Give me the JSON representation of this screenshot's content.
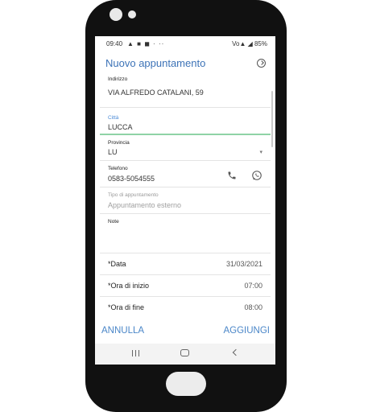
{
  "statusbar": {
    "time": "09:40",
    "notifications": "▲ ■ ◼ ·  ··",
    "right": "Vo▲ ◢ 85%"
  },
  "appbar": {
    "title": "Nuovo appuntamento",
    "action_icon": "clock-save-icon"
  },
  "form": {
    "indirizzo": {
      "label": "Indirizzo",
      "value": "VIA ALFREDO CATALANI, 59"
    },
    "citta": {
      "label": "Città",
      "value": "LUCCA"
    },
    "provincia": {
      "label": "Provincia",
      "value": "LU"
    },
    "telefono": {
      "label": "Telefono",
      "value": "0583-5054555"
    },
    "tipo": {
      "label": "Tipo di appuntamento",
      "placeholder": "Appuntamento esterno"
    },
    "note": {
      "label": "Note",
      "value": ""
    },
    "data": {
      "label": "*Data",
      "value": "31/03/2021"
    },
    "ora_inizio": {
      "label": "*Ora di inizio",
      "value": "07:00"
    },
    "ora_fine": {
      "label": "*Ora di fine",
      "value": "08:00"
    }
  },
  "actions": {
    "cancel": "ANNULLA",
    "add": "AGGIUNGI"
  },
  "colors": {
    "accent": "#3d73b7",
    "active_underline": "#8fd3a6",
    "phone_frame": "#111111"
  }
}
